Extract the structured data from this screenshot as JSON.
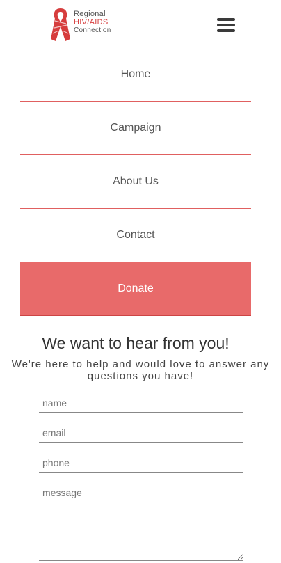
{
  "logo": {
    "line1": "Regional",
    "line2": "HIV/AIDS",
    "line3": "Connection",
    "icon": "red-ribbon-icon",
    "brand_color": "#d63d3d"
  },
  "header": {
    "menu_icon": "hamburger-menu-icon"
  },
  "nav": {
    "items": [
      {
        "label": "Home"
      },
      {
        "label": "Campaign"
      },
      {
        "label": "About Us"
      },
      {
        "label": "Contact"
      }
    ],
    "donate_label": "Donate",
    "donate_color": "#e86a6a",
    "divider_color": "#e06060"
  },
  "contact": {
    "title": "We want to hear from you!",
    "subtitle": "We're here to help and would love to answer any questions you have!",
    "fields": {
      "name_placeholder": "name",
      "email_placeholder": "email",
      "phone_placeholder": "phone",
      "message_placeholder": "message"
    }
  }
}
